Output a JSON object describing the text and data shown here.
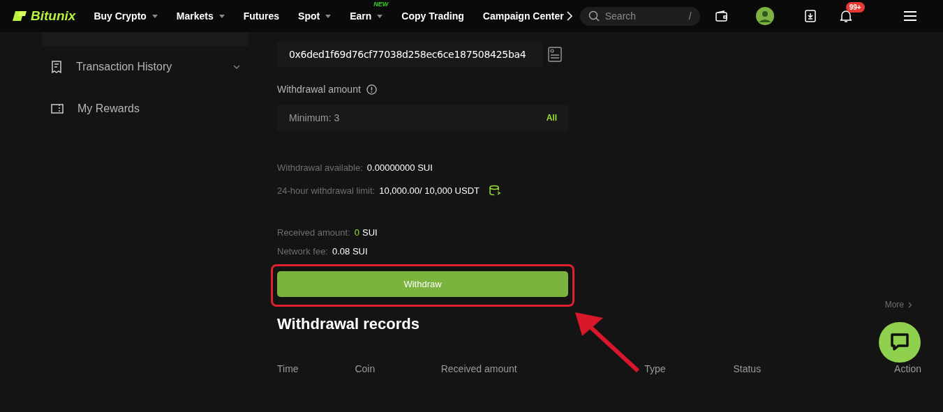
{
  "header": {
    "brand": "Bitunix",
    "nav": [
      {
        "label": "Buy Crypto",
        "dropdown": true
      },
      {
        "label": "Markets",
        "dropdown": true
      },
      {
        "label": "Futures",
        "dropdown": false
      },
      {
        "label": "Spot",
        "dropdown": true
      },
      {
        "label": "Earn",
        "dropdown": true,
        "badge": "NEW"
      },
      {
        "label": "Copy Trading",
        "dropdown": false
      },
      {
        "label": "Campaign Center",
        "dropdown": false
      }
    ],
    "search": {
      "placeholder": "Search",
      "shortcut": "/"
    },
    "notification_count": "99+"
  },
  "sidebar": {
    "items": [
      {
        "label": "Transaction History",
        "expandable": true
      },
      {
        "label": "My Rewards",
        "expandable": false
      }
    ]
  },
  "form": {
    "address": "0x6ded1f69d76cf77038d258ec6ce187508425ba4",
    "amount_label": "Withdrawal amount",
    "amount_placeholder": "Minimum: 3",
    "all_button": "All",
    "limits": [
      {
        "label": "Withdrawal available:",
        "value": "0.00000000 SUI"
      },
      {
        "label": "24-hour withdrawal limit:",
        "value": "10,000.00/ 10,000 USDT"
      }
    ],
    "received_label": "Received amount:",
    "received_value": "0",
    "received_unit": "SUI",
    "fee_label": "Network fee:",
    "fee_value": "0.08 SUI",
    "submit": "Withdraw"
  },
  "records": {
    "title": "Withdrawal records",
    "more": "More",
    "columns": [
      "Time",
      "Coin",
      "Received amount",
      "Type",
      "Status",
      "Action"
    ]
  }
}
